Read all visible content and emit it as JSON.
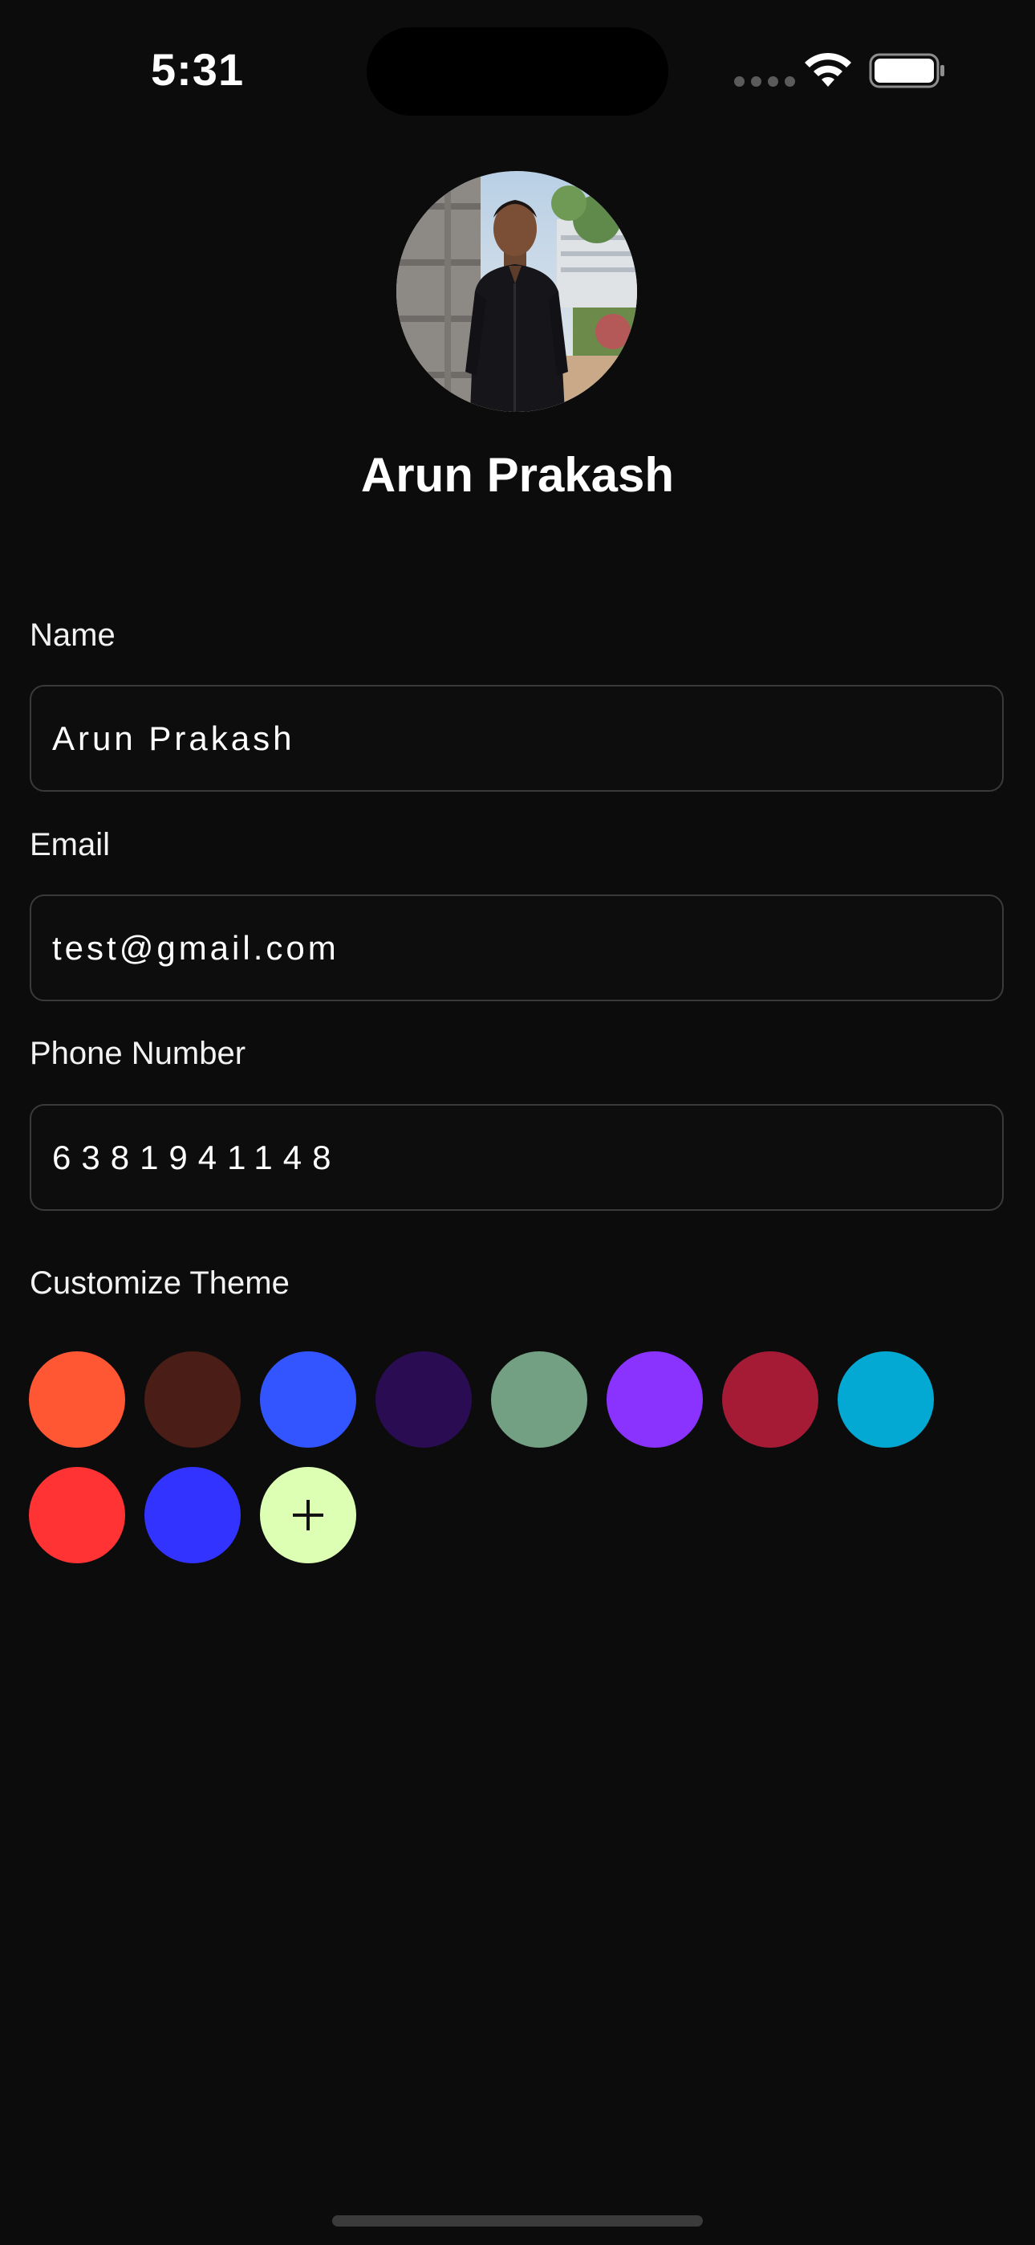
{
  "status_bar": {
    "time": "5:31"
  },
  "profile": {
    "display_name": "Arun Prakash",
    "avatar_icon": "profile-photo"
  },
  "form": {
    "name": {
      "label": "Name",
      "value": "Arun Prakash"
    },
    "email": {
      "label": "Email",
      "value": "test@gmail.com"
    },
    "phone": {
      "label": "Phone Number",
      "value": "6381941148"
    }
  },
  "theme": {
    "label": "Customize Theme",
    "swatches": [
      "#FF5733",
      "#4A1D16",
      "#3355FF",
      "#2A0C52",
      "#73A083",
      "#8A33FF",
      "#A51B36",
      "#03A9D2",
      "#FF3333",
      "#3333FF"
    ],
    "add_button": {
      "icon": "plus-icon",
      "color": "#DDFFB3"
    }
  }
}
